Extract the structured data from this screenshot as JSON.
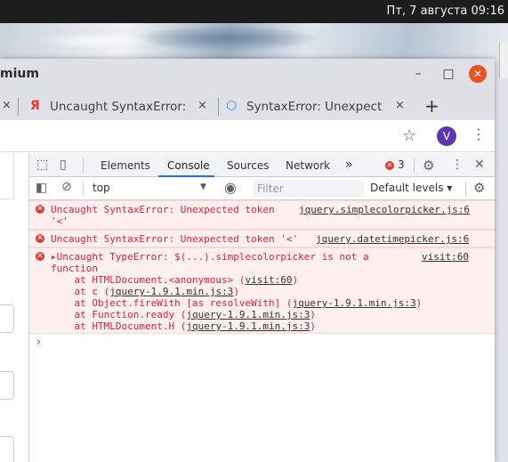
{
  "system": {
    "clock": "Пт, 7 августа  09:16"
  },
  "window": {
    "title": "mium"
  },
  "tabs": [
    {
      "title": "",
      "icon": ""
    },
    {
      "title": "Uncaught SyntaxError: ",
      "icon": "yandex-icon",
      "icon_glyph": "Я"
    },
    {
      "title": "SyntaxError: Unexpect",
      "icon": "puzzle-icon",
      "icon_glyph": "⬡"
    }
  ],
  "tab_close_glyph": "×",
  "new_tab_glyph": "+",
  "toolbar": {
    "avatar_letter": "V"
  },
  "devtools": {
    "tabs": [
      "Elements",
      "Console",
      "Sources",
      "Network"
    ],
    "more": "»",
    "error_count": "3",
    "context": "top",
    "filter_placeholder": "Filter",
    "levels": "Default levels ▾",
    "messages": [
      {
        "lines": [
          "Uncaught SyntaxError: Unexpected token",
          "'<'"
        ],
        "source": "jquery.simplecolorpicker.js:6"
      },
      {
        "lines": [
          "Uncaught SyntaxError: Unexpected token '<'"
        ],
        "source": "jquery.datetimepicker.js:6"
      },
      {
        "lines": [
          "▸Uncaught TypeError: $(...).simplecolorpicker is not a",
          "function"
        ],
        "source": "visit:60",
        "stack": [
          {
            "pre": "    at HTMLDocument.<anonymous> (",
            "link": "visit:60",
            "post": ")"
          },
          {
            "pre": "    at c (",
            "link": "jquery-1.9.1.min.js:3",
            "post": ")"
          },
          {
            "pre": "    at Object.fireWith [as resolveWith] (",
            "link": "jquery-1.9.1.min.js:3",
            "post": ")"
          },
          {
            "pre": "    at Function.ready (",
            "link": "jquery-1.9.1.min.js:3",
            "post": ")"
          },
          {
            "pre": "    at HTMLDocument.H (",
            "link": "jquery-1.9.1.min.js:3",
            "post": ")"
          }
        ]
      }
    ],
    "prompt": "›"
  },
  "colors": {
    "accent": "#1a73e8",
    "error": "#e0203b",
    "close": "#e95420",
    "avatar": "#5e35b1"
  }
}
